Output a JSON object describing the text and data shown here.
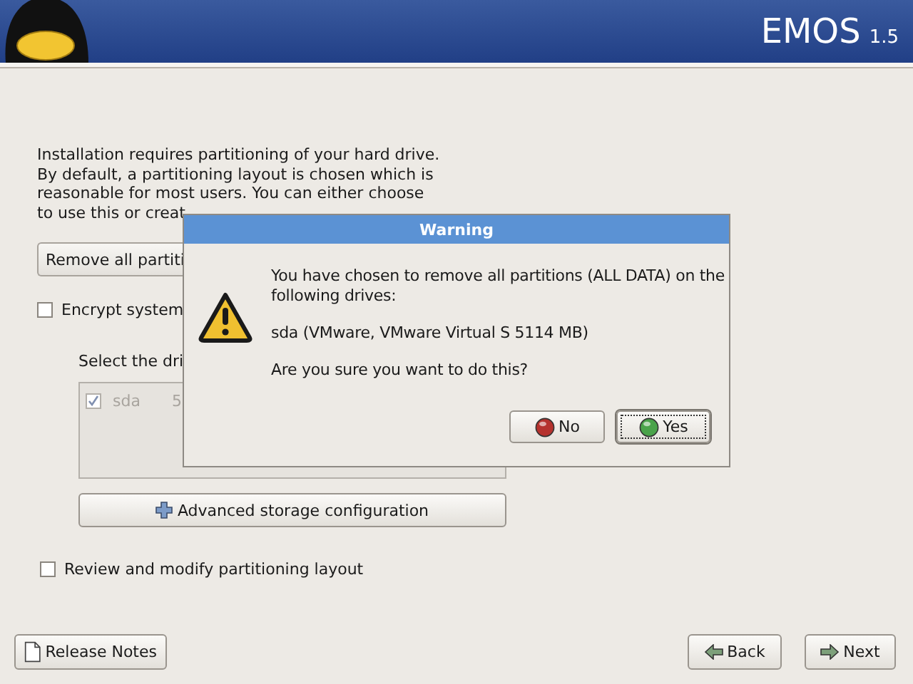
{
  "header": {
    "title": "EMOS",
    "version": "1.5"
  },
  "intro_lines": [
    "Installation requires partitioning of your hard drive.",
    "By default, a partitioning layout is chosen which is",
    "reasonable for most users.  You can either choose",
    "to use this or creat"
  ],
  "partition_dropdown": {
    "value": "Remove all partiti"
  },
  "encrypt_checkbox": {
    "label": "Encrypt system",
    "checked": false
  },
  "drive_label": "Select the dri",
  "drives": [
    {
      "checked": true,
      "disabled": true,
      "name": "sda",
      "column_2": "5"
    }
  ],
  "advanced_button": {
    "label": "Advanced storage configuration"
  },
  "review_checkbox": {
    "label": "Review and modify partitioning layout",
    "checked": false
  },
  "footer_buttons": [
    {
      "kind": "notes",
      "label": "Release Notes"
    },
    {
      "kind": "back",
      "label": "Back"
    },
    {
      "kind": "next",
      "label": "Next"
    }
  ],
  "dialog": {
    "title": "Warning",
    "message_lines": [
      "You have chosen to remove all partitions (ALL DATA) on the",
      "following drives:"
    ],
    "drive": "sda (VMware, VMware Virtual S 5114 MB)",
    "question": "Are you sure you want to do this?",
    "buttons": [
      {
        "kind": "no",
        "label": "No",
        "selected": false
      },
      {
        "kind": "yes",
        "label": "Yes",
        "selected": true
      }
    ]
  }
}
